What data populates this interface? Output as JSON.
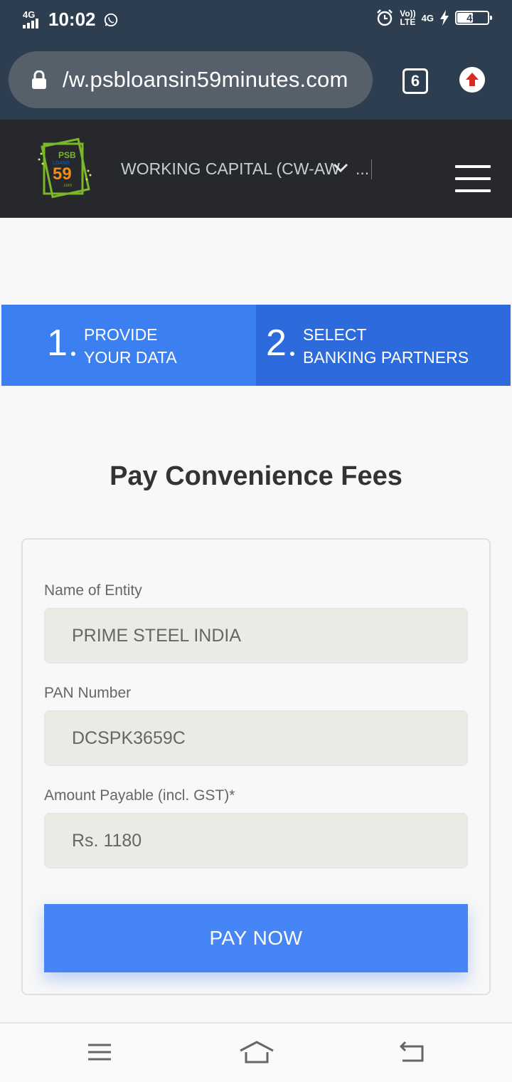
{
  "status_bar": {
    "network": "4G",
    "time": "10:02",
    "volte_top": "Vo))",
    "volte_bottom": "LTE",
    "network_right": "4G",
    "battery": "49",
    "icons": [
      "signal-icon",
      "whatsapp-icon",
      "alarm-icon",
      "charging-icon",
      "battery-icon"
    ]
  },
  "browser": {
    "url": "/w.psbloansin59minutes.com",
    "tab_count": "6",
    "icons": [
      "lock-icon",
      "update-icon"
    ]
  },
  "header": {
    "loan_type": "WORKING CAPITAL (CW-AW",
    "loan_type_ellipsis": "...",
    "logo_text": "PSB",
    "logo_number": "59",
    "logo_small": "LOANS",
    "logo_domain": ".com",
    "colors": {
      "background": "#26282b",
      "logo_green": "#7ab82a",
      "logo_orange": "#f28c12"
    }
  },
  "steps": [
    {
      "number": "1",
      "line1": "PROVIDE",
      "line2": "YOUR DATA"
    },
    {
      "number": "2",
      "line1": "SELECT",
      "line2": "BANKING PARTNERS"
    }
  ],
  "page": {
    "title": "Pay Convenience Fees"
  },
  "form": {
    "entity_label": "Name of Entity",
    "entity_value": "PRIME STEEL INDIA",
    "pan_label": "PAN Number",
    "pan_value": "DCSPK3659C",
    "amount_label": "Amount Payable (incl. GST)*",
    "amount_value": "Rs. 1180",
    "pay_button": "PAY NOW",
    "colors": {
      "button": "#4685f6",
      "step1": "#3b7ff0",
      "step2": "#2d6adb"
    }
  },
  "navbar": {
    "icons": [
      "menu-icon",
      "home-icon",
      "back-icon"
    ]
  }
}
